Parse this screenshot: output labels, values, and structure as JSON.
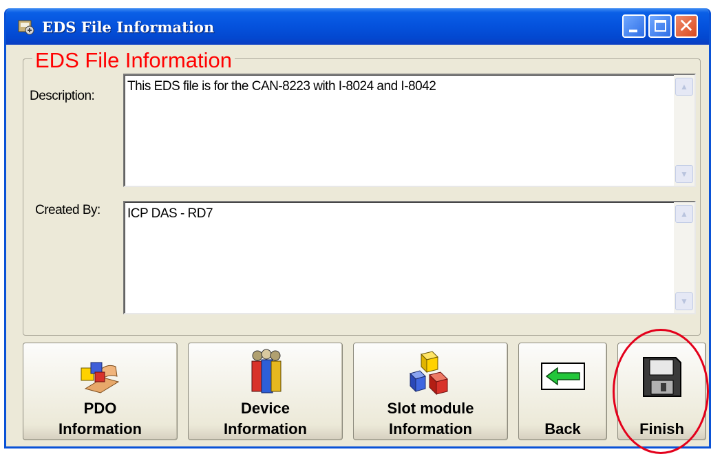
{
  "window": {
    "title": "EDS File Information",
    "controls": [
      "minimize",
      "maximize",
      "close"
    ]
  },
  "group": {
    "label": "EDS File Information",
    "label_color": "#ff0000"
  },
  "fields": {
    "description": {
      "label": "Description:",
      "value": "This EDS file is for the CAN-8223 with I-8024 and I-8042"
    },
    "created_by": {
      "label": "Created By:",
      "value": "ICP DAS - RD7"
    }
  },
  "buttons": {
    "pdo": {
      "line1": "PDO",
      "line2": "Information",
      "icon": "pdo-icon"
    },
    "device": {
      "line1": "Device",
      "line2": "Information",
      "icon": "people-icon"
    },
    "slot": {
      "line1": "Slot module",
      "line2": "Information",
      "icon": "blocks-icon"
    },
    "back": {
      "label": "Back",
      "icon": "arrow-left-icon"
    },
    "finish": {
      "label": "Finish",
      "icon": "floppy-disk-icon"
    }
  },
  "annotation": {
    "type": "circle",
    "target": "finish",
    "color": "#e3001b"
  }
}
